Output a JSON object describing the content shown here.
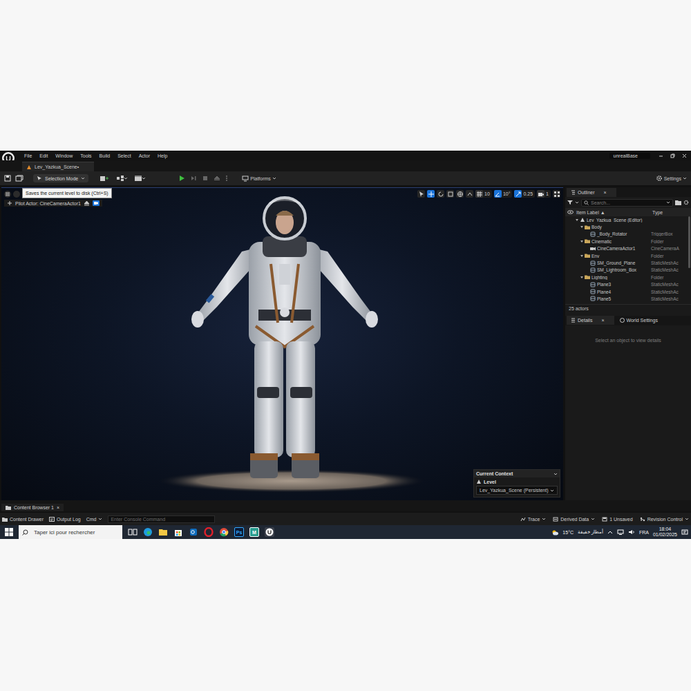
{
  "window": {
    "title": "unrealBase"
  },
  "menu": [
    "File",
    "Edit",
    "Window",
    "Tools",
    "Build",
    "Select",
    "Actor",
    "Help"
  ],
  "document_tabs": [
    {
      "label": "Lev_Yazkua_Scene•",
      "selected": true
    }
  ],
  "toolbar": {
    "tooltip": "Saves the current level to disk (Ctrl+S)",
    "mode": "Selection Mode",
    "platforms": "Platforms",
    "settings": "Settings"
  },
  "viewport": {
    "pilot": "Pilot Actor: CineCameraActor1",
    "snaps": [
      {
        "value": "10",
        "on": false
      },
      {
        "value": "10°",
        "on": true
      },
      {
        "value": "0.25",
        "on": true
      },
      {
        "value": "1",
        "on": false
      }
    ],
    "context": {
      "title": "Current Context",
      "label": "Level",
      "value": "Lev_Yazkua_Scene (Persistent)"
    }
  },
  "outliner": {
    "tab": {
      "label": "Outliner",
      "close": "×",
      "selected": true
    },
    "search": {
      "placeholder": "Search..."
    },
    "columns": [
      "Item Label ▲",
      "Type"
    ],
    "rows": [
      {
        "label": "Lev_Yazkua_Scene (Editor)",
        "kind": "level",
        "depth": 0,
        "expanded": true
      },
      {
        "label": "Body",
        "kind": "folder",
        "depth": 1,
        "expanded": true
      },
      {
        "label": "_Body_Rotator",
        "type": "TriggerBox",
        "kind": "actor",
        "depth": 2
      },
      {
        "label": "Cinematic",
        "type": "Folder",
        "kind": "folder",
        "depth": 1,
        "expanded": true
      },
      {
        "label": "CineCameraActor1",
        "type": "CineCameraA",
        "kind": "camera",
        "depth": 2
      },
      {
        "label": "Env",
        "type": "Folder",
        "kind": "folder",
        "depth": 1,
        "expanded": true
      },
      {
        "label": "SM_Ground_Plane",
        "type": "StaticMeshAc",
        "kind": "actor",
        "depth": 2
      },
      {
        "label": "SM_Lightroom_Box",
        "type": "StaticMeshAc",
        "kind": "actor",
        "depth": 2
      },
      {
        "label": "Lighting",
        "type": "Folder",
        "kind": "folder",
        "depth": 1,
        "expanded": true
      },
      {
        "label": "Plane3",
        "type": "StaticMeshAc",
        "kind": "actor",
        "depth": 2
      },
      {
        "label": "Plane4",
        "type": "StaticMeshAc",
        "kind": "actor",
        "depth": 2
      },
      {
        "label": "Plane5",
        "type": "StaticMeshAc",
        "kind": "actor",
        "depth": 2
      }
    ],
    "count": "25 actors"
  },
  "details": {
    "tabs": [
      {
        "label": "Details",
        "close": "×",
        "selected": true
      },
      {
        "label": "World Settings",
        "selected": false
      }
    ],
    "empty": "Select an object to view details"
  },
  "bottom_tabs": [
    {
      "label": "Content Browser 1",
      "close": "×",
      "selected": true
    }
  ],
  "status_bar": {
    "left": [
      "Content Drawer",
      "Output Log",
      "Cmd"
    ],
    "console": {
      "placeholder": "Enter Console Command"
    },
    "right": [
      "Trace",
      "Derived Data",
      "1 Unsaved",
      "Revision Control"
    ]
  },
  "taskbar": {
    "search": {
      "placeholder": "Taper ici pour rechercher"
    },
    "app_badges": [
      "Ps",
      "M"
    ],
    "temperature": "15°C",
    "weather": "أمطار خفيفة",
    "language": "FRA",
    "time": "18:04",
    "date": "01/02/2025"
  }
}
